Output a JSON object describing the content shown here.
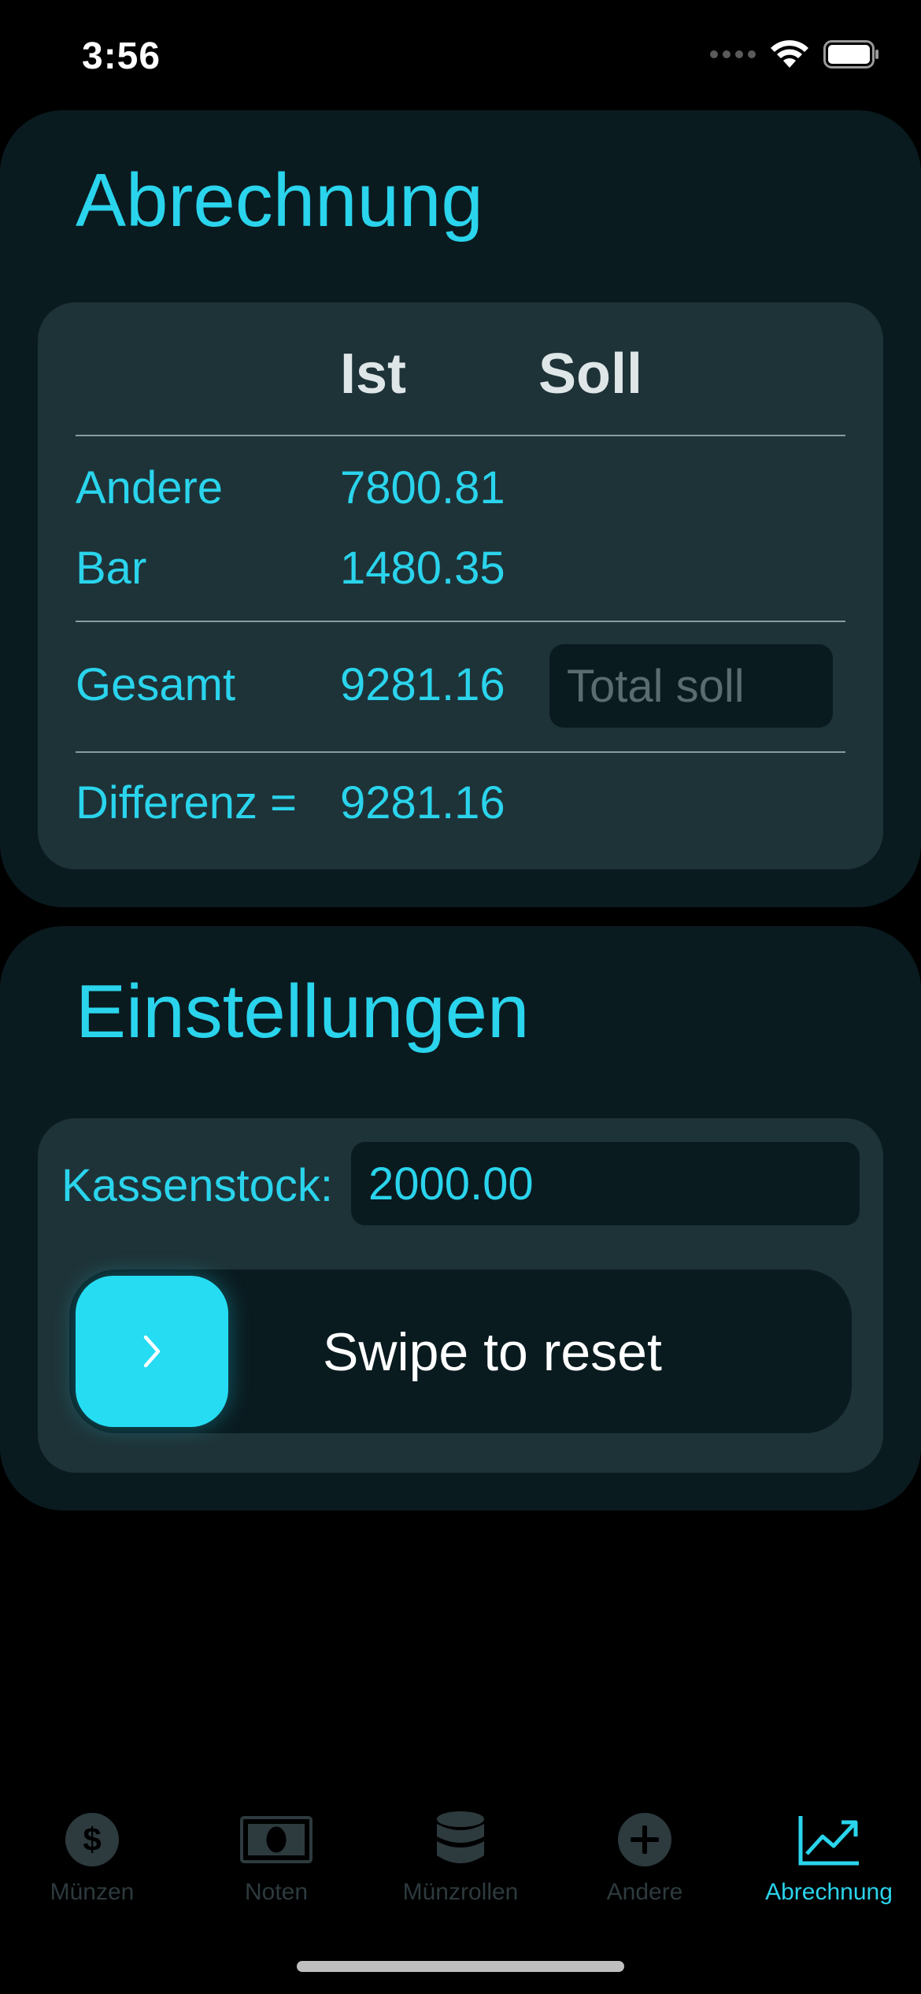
{
  "status_bar": {
    "time": "3:56"
  },
  "abrechnung": {
    "title": "Abrechnung",
    "col_ist": "Ist",
    "col_soll": "Soll",
    "rows": [
      {
        "label": "Andere",
        "ist": "7800.81"
      },
      {
        "label": "Bar",
        "ist": "1480.35"
      }
    ],
    "total": {
      "label": "Gesamt",
      "ist": "9281.16",
      "soll_placeholder": "Total soll",
      "soll_value": ""
    },
    "difference": {
      "label": "Differenz =",
      "value": "9281.16"
    }
  },
  "einstellungen": {
    "title": "Einstellungen",
    "kassenstock_label": "Kassenstock:",
    "kassenstock_value": "2000.00",
    "swipe_label": "Swipe to reset"
  },
  "tab_bar": {
    "tabs": [
      {
        "label": "Münzen",
        "icon": "dollar-circle-icon"
      },
      {
        "label": "Noten",
        "icon": "banknote-icon"
      },
      {
        "label": "Münzrollen",
        "icon": "coin-stack-icon"
      },
      {
        "label": "Andere",
        "icon": "plus-circle-icon"
      },
      {
        "label": "Abrechnung",
        "icon": "chart-trend-icon"
      }
    ],
    "active": "Abrechnung"
  },
  "colors": {
    "accent": "#2ad4ec",
    "card_bg": "#0a1b20",
    "inner_bg": "#1e3338",
    "tab_inactive": "#2d3a3e"
  }
}
